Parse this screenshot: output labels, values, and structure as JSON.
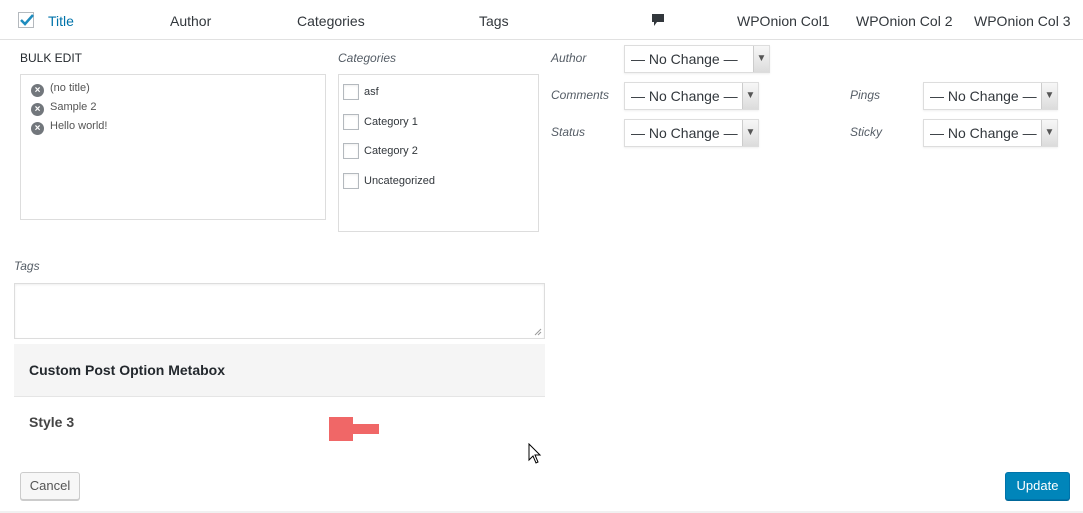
{
  "header": {
    "columns": {
      "title": "Title",
      "author": "Author",
      "categories": "Categories",
      "tags": "Tags",
      "col1": "WPOnion Col1",
      "col2": "WPOnion Col 2",
      "col3": "WPOnion Col 3"
    },
    "select_all_checked": true,
    "comment_icon": "comment-bubble-icon"
  },
  "bulk_edit": {
    "heading": "BULK EDIT",
    "titles": [
      "(no title)",
      "Sample 2",
      "Hello world!"
    ],
    "remove_icon": "remove-circle-icon"
  },
  "categories": {
    "label": "Categories",
    "items": [
      "asf",
      "Category 1",
      "Category 2",
      "Uncategorized"
    ]
  },
  "fields": {
    "author_label": "Author",
    "author_value": "— No Change —",
    "comments_label": "Comments",
    "comments_value": "— No Change —",
    "status_label": "Status",
    "status_value": "— No Change —",
    "pings_label": "Pings",
    "pings_value": "— No Change —",
    "sticky_label": "Sticky",
    "sticky_value": "— No Change —"
  },
  "tags": {
    "label": "Tags",
    "value": ""
  },
  "metabox": {
    "title": "Custom Post Option Metabox",
    "style_label": "Style 3",
    "accent_color": "#f06767"
  },
  "buttons": {
    "cancel": "Cancel",
    "update": "Update"
  },
  "colors": {
    "link": "#0073aa",
    "primary": "#0085ba"
  }
}
